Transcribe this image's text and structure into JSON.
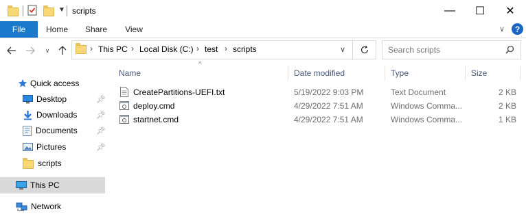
{
  "window": {
    "title": "scripts",
    "controls": {
      "minimize": "—",
      "maximize": "☐",
      "close": "✕"
    }
  },
  "ribbon": {
    "tabs": [
      "File",
      "Home",
      "Share",
      "View"
    ],
    "help": "?"
  },
  "address": {
    "breadcrumbs": [
      "This PC",
      "Local Disk (C:)",
      "test",
      "scripts"
    ],
    "search_placeholder": "Search scripts"
  },
  "nav": {
    "quick_access": "Quick access",
    "items": [
      {
        "label": "Desktop",
        "pinned": true,
        "icon": "desktop-icon"
      },
      {
        "label": "Downloads",
        "pinned": true,
        "icon": "downloads-icon"
      },
      {
        "label": "Documents",
        "pinned": true,
        "icon": "documents-icon"
      },
      {
        "label": "Pictures",
        "pinned": true,
        "icon": "pictures-icon"
      },
      {
        "label": "scripts",
        "pinned": false,
        "icon": "folder-icon"
      }
    ],
    "this_pc": "This PC",
    "network": "Network"
  },
  "columns": [
    "Name",
    "Date modified",
    "Type",
    "Size"
  ],
  "files": [
    {
      "name": "CreatePartitions-UEFI.txt",
      "date": "5/19/2022 9:03 PM",
      "type": "Text Document",
      "size": "2 KB",
      "icon": "text-file-icon"
    },
    {
      "name": "deploy.cmd",
      "date": "4/29/2022 7:51 AM",
      "type": "Windows Comma...",
      "size": "2 KB",
      "icon": "cmd-file-icon"
    },
    {
      "name": "startnet.cmd",
      "date": "4/29/2022 7:51 AM",
      "type": "Windows Comma...",
      "size": "1 KB",
      "icon": "cmd-file-icon"
    }
  ],
  "colors": {
    "file_tab": "#1979ca",
    "selected_nav": "#d9d9d9",
    "folder": "#f8d775",
    "header_text": "#44587a"
  }
}
